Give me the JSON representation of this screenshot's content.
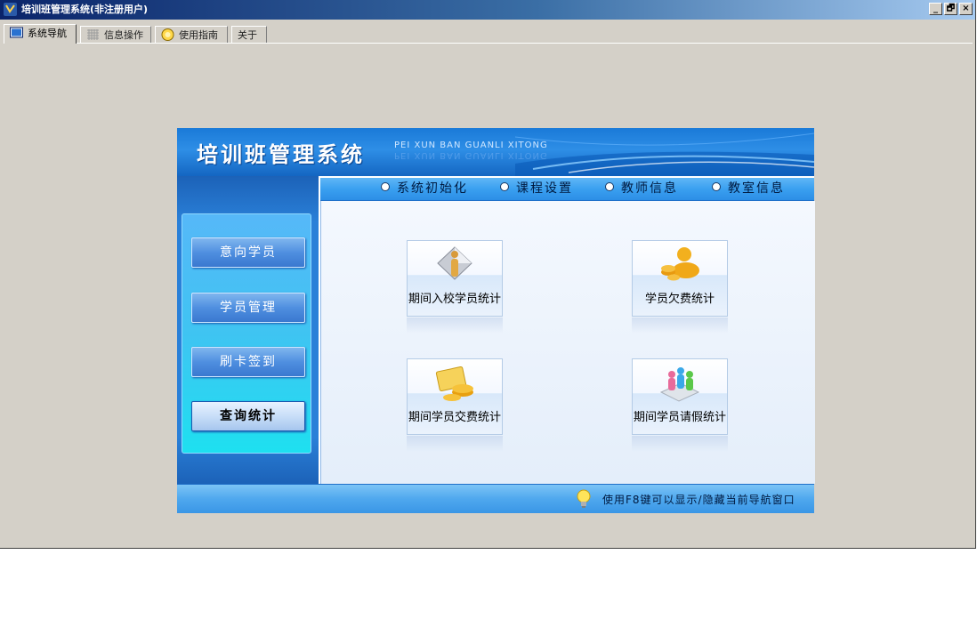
{
  "window": {
    "title": "培训班管理系统(非注册用户)",
    "controls": {
      "minimize": "_",
      "restore": "🗗",
      "close": "×"
    }
  },
  "tabs": [
    {
      "label": "系统导航",
      "icon": "monitor-icon",
      "active": true
    },
    {
      "label": "信息操作",
      "icon": "grid-icon",
      "active": false
    },
    {
      "label": "使用指南",
      "icon": "guide-icon",
      "active": false
    },
    {
      "label": "关于",
      "icon": "",
      "active": false
    }
  ],
  "banner": {
    "title": "培训班管理系统",
    "subtitle": "PEI XUN BAN GUANLI XITONG"
  },
  "top_nav": [
    {
      "label": "系统初始化"
    },
    {
      "label": "课程设置"
    },
    {
      "label": "教师信息"
    },
    {
      "label": "教室信息"
    }
  ],
  "sidebar": [
    {
      "label": "意向学员",
      "selected": false
    },
    {
      "label": "学员管理",
      "selected": false
    },
    {
      "label": "刷卡签到",
      "selected": false
    },
    {
      "label": "查询统计",
      "selected": true
    }
  ],
  "cards": [
    {
      "label": "期间入校学员统计",
      "icon": "person-diamond-icon"
    },
    {
      "label": "学员欠费统计",
      "icon": "coins-person-icon"
    },
    {
      "label": "期间学员交费统计",
      "icon": "payment-icon"
    },
    {
      "label": "期间学员请假统计",
      "icon": "people-group-icon"
    }
  ],
  "status": {
    "tip": "使用F8键可以显示/隐藏当前导航窗口",
    "icon": "lightbulb-icon"
  },
  "colors": {
    "titlebar_start": "#0a246a",
    "titlebar_end": "#a6caf0",
    "banner_blue": "#1a7ad8",
    "window_face": "#d4d0c8"
  }
}
